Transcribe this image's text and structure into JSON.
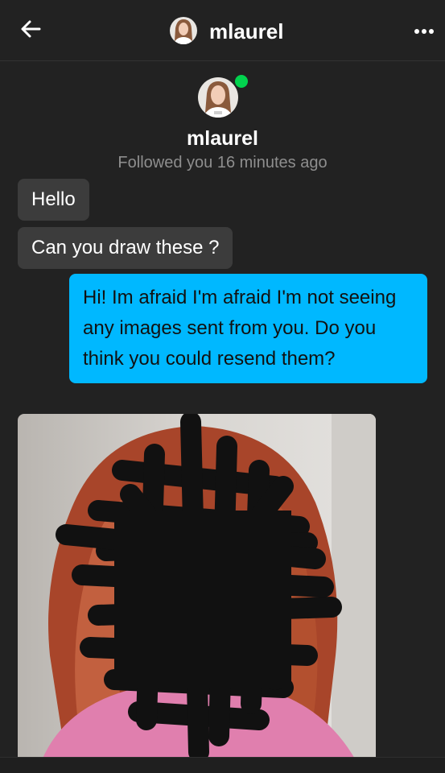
{
  "header": {
    "username": "mlaurel",
    "back_icon": "arrow-left-icon",
    "more_icon": "more-dots-icon"
  },
  "profile": {
    "username": "mlaurel",
    "subtitle": "Followed you 16 minutes ago",
    "online": true
  },
  "messages": [
    {
      "direction": "incoming",
      "text": "Hello"
    },
    {
      "direction": "incoming",
      "text": "Can you draw these ?"
    },
    {
      "direction": "outgoing",
      "text": "Hi! Im afraid I'm afraid I'm not seeing any images sent from you. Do you think you could resend them?"
    },
    {
      "direction": "incoming",
      "type": "image",
      "description": "photo"
    }
  ],
  "colors": {
    "background": "#222222",
    "incoming_bubble": "#3c3c3c",
    "outgoing_bubble": "#00b8ff",
    "online_dot": "#02d34e",
    "subtitle": "#8e8e8e"
  }
}
